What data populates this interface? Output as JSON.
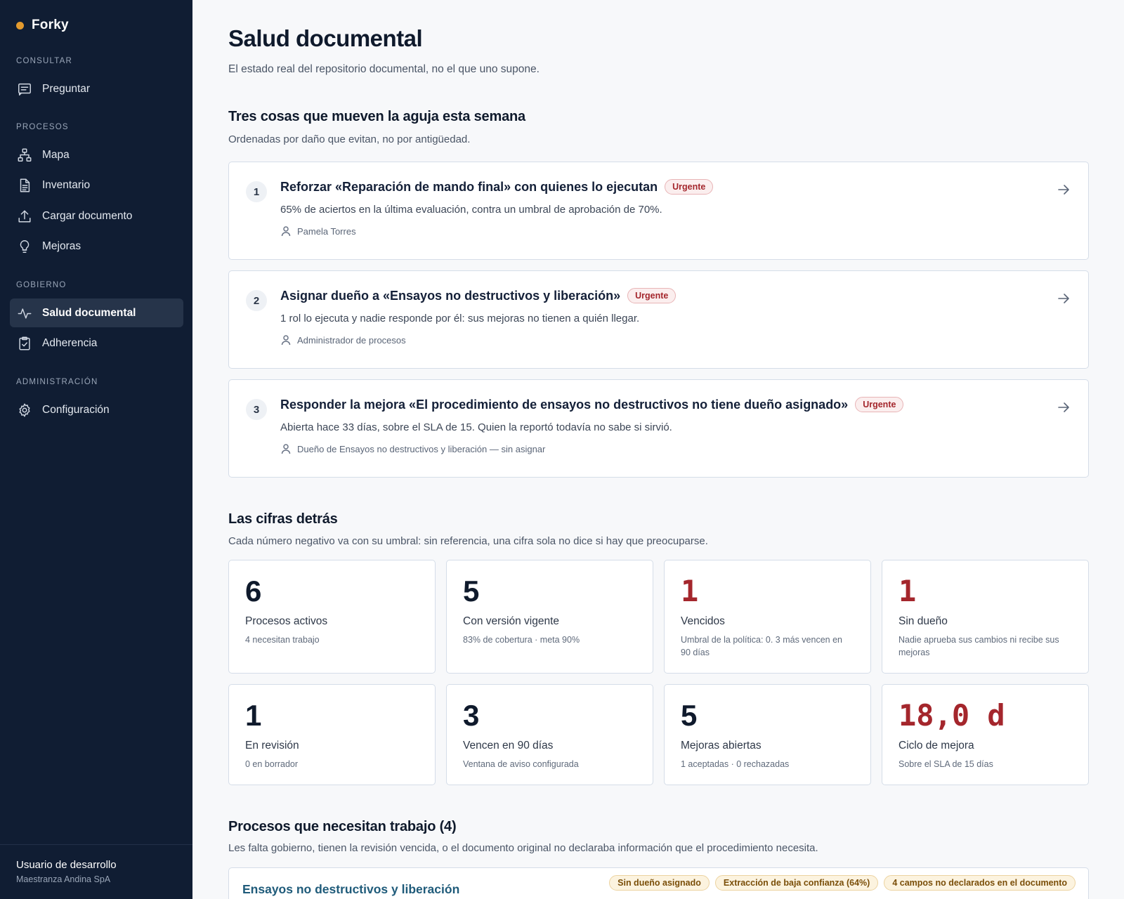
{
  "app": {
    "name": "Forky",
    "accent": "#e39a2e"
  },
  "sidebar": {
    "sections": [
      {
        "heading": "CONSULTAR",
        "items": [
          {
            "label": "Preguntar",
            "icon": "chat-icon"
          }
        ]
      },
      {
        "heading": "PROCESOS",
        "items": [
          {
            "label": "Mapa",
            "icon": "sitemap-icon"
          },
          {
            "label": "Inventario",
            "icon": "document-icon"
          },
          {
            "label": "Cargar documento",
            "icon": "upload-icon"
          },
          {
            "label": "Mejoras",
            "icon": "lightbulb-icon"
          }
        ]
      },
      {
        "heading": "GOBIERNO",
        "items": [
          {
            "label": "Salud documental",
            "icon": "pulse-icon",
            "active": true
          },
          {
            "label": "Adherencia",
            "icon": "clipboard-check-icon"
          }
        ]
      },
      {
        "heading": "ADMINISTRACIÓN",
        "items": [
          {
            "label": "Configuración",
            "icon": "gear-icon"
          }
        ]
      }
    ],
    "footer": {
      "user": "Usuario de desarrollo",
      "org": "Maestranza Andina SpA"
    }
  },
  "page": {
    "title": "Salud documental",
    "subtitle": "El estado real del repositorio documental, no el que uno supone."
  },
  "priorities": {
    "title": "Tres cosas que mueven la aguja esta semana",
    "subtitle": "Ordenadas por daño que evitan, no por antigüedad.",
    "items": [
      {
        "num": "1",
        "title": "Reforzar «Reparación de mando final» con quienes lo ejecutan",
        "badge": "Urgente",
        "desc": "65% de aciertos en la última evaluación, contra un umbral de aprobación de 70%.",
        "owner": "Pamela Torres"
      },
      {
        "num": "2",
        "title": "Asignar dueño a «Ensayos no destructivos y liberación»",
        "badge": "Urgente",
        "desc": "1 rol lo ejecuta y nadie responde por él: sus mejoras no tienen a quién llegar.",
        "owner": "Administrador de procesos"
      },
      {
        "num": "3",
        "title": "Responder la mejora «El procedimiento de ensayos no destructivos no tiene dueño asignado»",
        "badge": "Urgente",
        "desc": "Abierta hace 33 días, sobre el SLA de 15. Quien la reportó todavía no sabe si sirvió.",
        "owner": "Dueño de Ensayos no destructivos y liberación — sin asignar"
      }
    ]
  },
  "figures": {
    "title": "Las cifras detrás",
    "subtitle": "Cada número negativo va con su umbral: sin referencia, una cifra sola no dice si hay que preocuparse.",
    "metrics": [
      {
        "value": "6",
        "label": "Procesos activos",
        "note": "4 necesitan trabajo",
        "alert": false
      },
      {
        "value": "5",
        "label": "Con versión vigente",
        "note": "83% de cobertura · meta 90%",
        "alert": false
      },
      {
        "value": "1",
        "label": "Vencidos",
        "note": "Umbral de la política: 0. 3 más vencen en 90 días",
        "alert": true
      },
      {
        "value": "1",
        "label": "Sin dueño",
        "note": "Nadie aprueba sus cambios ni recibe sus mejoras",
        "alert": true
      },
      {
        "value": "1",
        "label": "En revisión",
        "note": "0 en borrador",
        "alert": false
      },
      {
        "value": "3",
        "label": "Vencen en 90 días",
        "note": "Ventana de aviso configurada",
        "alert": false
      },
      {
        "value": "5",
        "label": "Mejoras abiertas",
        "note": "1 aceptadas · 0 rechazadas",
        "alert": false
      },
      {
        "value": "18,0 d",
        "label": "Ciclo de mejora",
        "note": "Sobre el SLA de 15 días",
        "alert": true
      }
    ]
  },
  "processes": {
    "title": "Procesos que necesitan trabajo (4)",
    "subtitle": "Les falta gobierno, tienen la revisión vencida, o el documento original no declaraba información que el procedimiento necesita.",
    "items": [
      {
        "name": "Ensayos no destructivos y liberación",
        "tags": [
          "Sin dueño asignado",
          "Extracción de baja confianza (64%)",
          "4 campos no declarados en el documento"
        ]
      }
    ]
  },
  "colors": {
    "sidebar_bg": "#101d33",
    "alert": "#a4262c",
    "link": "#1f5b7a",
    "warning_tag": "#fcf3df"
  }
}
